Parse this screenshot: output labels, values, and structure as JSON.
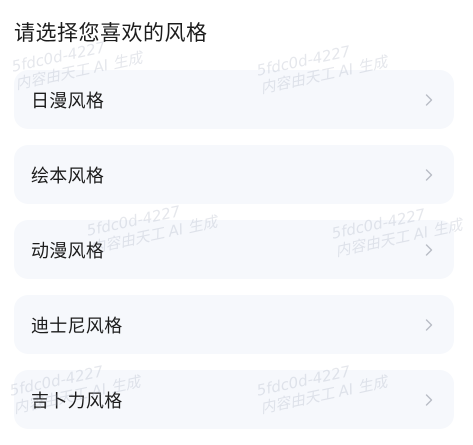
{
  "page": {
    "title": "请选择您喜欢的风格"
  },
  "options": [
    {
      "label": "日漫风格"
    },
    {
      "label": "绘本风格"
    },
    {
      "label": "动漫风格"
    },
    {
      "label": "迪士尼风格"
    },
    {
      "label": "吉卜力风格"
    }
  ],
  "watermark": {
    "line1": "5fdc0d-4227",
    "line2": "内容由天工 AI 生成"
  },
  "colors": {
    "card_background": "#f6f8fc",
    "chevron": "#b8bcc4"
  },
  "icons": {
    "option_chevron": "chevron-right-icon"
  }
}
